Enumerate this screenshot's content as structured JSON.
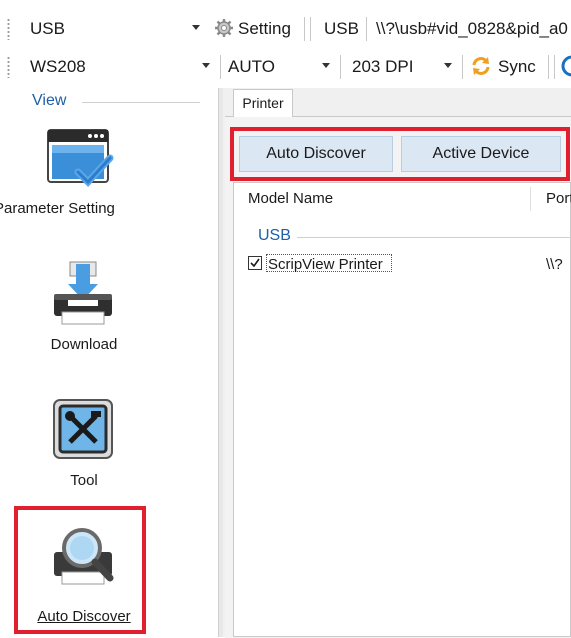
{
  "toolbar_top": {
    "interface_value": "USB",
    "setting_label": "Setting",
    "port_type": "USB",
    "device_path": "\\\\?\\usb#vid_0828&pid_a0"
  },
  "toolbar_second": {
    "model_value": "WS208",
    "mode_value": "AUTO",
    "dpi_value": "203 DPI",
    "sync_label": "Sync"
  },
  "left_panel": {
    "group_title": "View",
    "items": [
      {
        "label": "Parameter Setting",
        "icon": "parameter-window-icon"
      },
      {
        "label": "Download",
        "icon": "download-printer-icon"
      },
      {
        "label": "Tool",
        "icon": "tools-icon"
      },
      {
        "label": "Auto Discover",
        "icon": "auto-discover-icon"
      }
    ]
  },
  "right_panel": {
    "tab_label": "Printer",
    "auto_discover_button": "Auto Discover",
    "active_device_button": "Active Device",
    "columns": [
      "Model Name",
      "Port"
    ],
    "group_label": "USB",
    "rows": [
      {
        "model": "ScripView Printer",
        "port": "\\\\?",
        "checked": true
      }
    ]
  },
  "colors": {
    "highlight_red": "#e01f2f",
    "accent_blue": "#1f5fa8",
    "button_blue": "#dbe7f3"
  }
}
